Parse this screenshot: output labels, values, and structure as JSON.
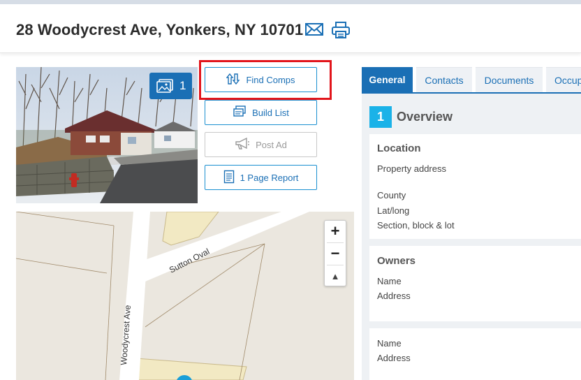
{
  "header": {
    "title": "28 Woodycrest Ave, Yonkers, NY 10701",
    "email_icon": "envelope-icon",
    "print_icon": "printer-icon"
  },
  "photo": {
    "count": "1",
    "badge_icon": "photos-icon"
  },
  "actions": {
    "find_comps": "Find Comps",
    "build_list": "Build List",
    "post_ad": "Post Ad",
    "page_report": "1 Page Report"
  },
  "map": {
    "street_1": "Sutton Oval",
    "street_2": "Woodycrest Ave",
    "zoom_in": "+",
    "zoom_out": "−",
    "reset_north": "▲"
  },
  "tabs": [
    {
      "label": "General"
    },
    {
      "label": "Contacts"
    },
    {
      "label": "Documents"
    },
    {
      "label": "Occup"
    }
  ],
  "overview": {
    "number": "1",
    "title": "Overview"
  },
  "location": {
    "heading": "Location",
    "property_address": "Property address",
    "county": "County",
    "lat_long": "Lat/long",
    "section_block_lot": "Section, block & lot"
  },
  "owners": {
    "heading": "Owners",
    "name": "Name",
    "address": "Address"
  },
  "owner2": {
    "name": "Name",
    "address": "Address"
  },
  "colors": {
    "accent": "#1a6fb5",
    "highlight": "#e2151b",
    "overview_badge": "#1ab2e8"
  }
}
